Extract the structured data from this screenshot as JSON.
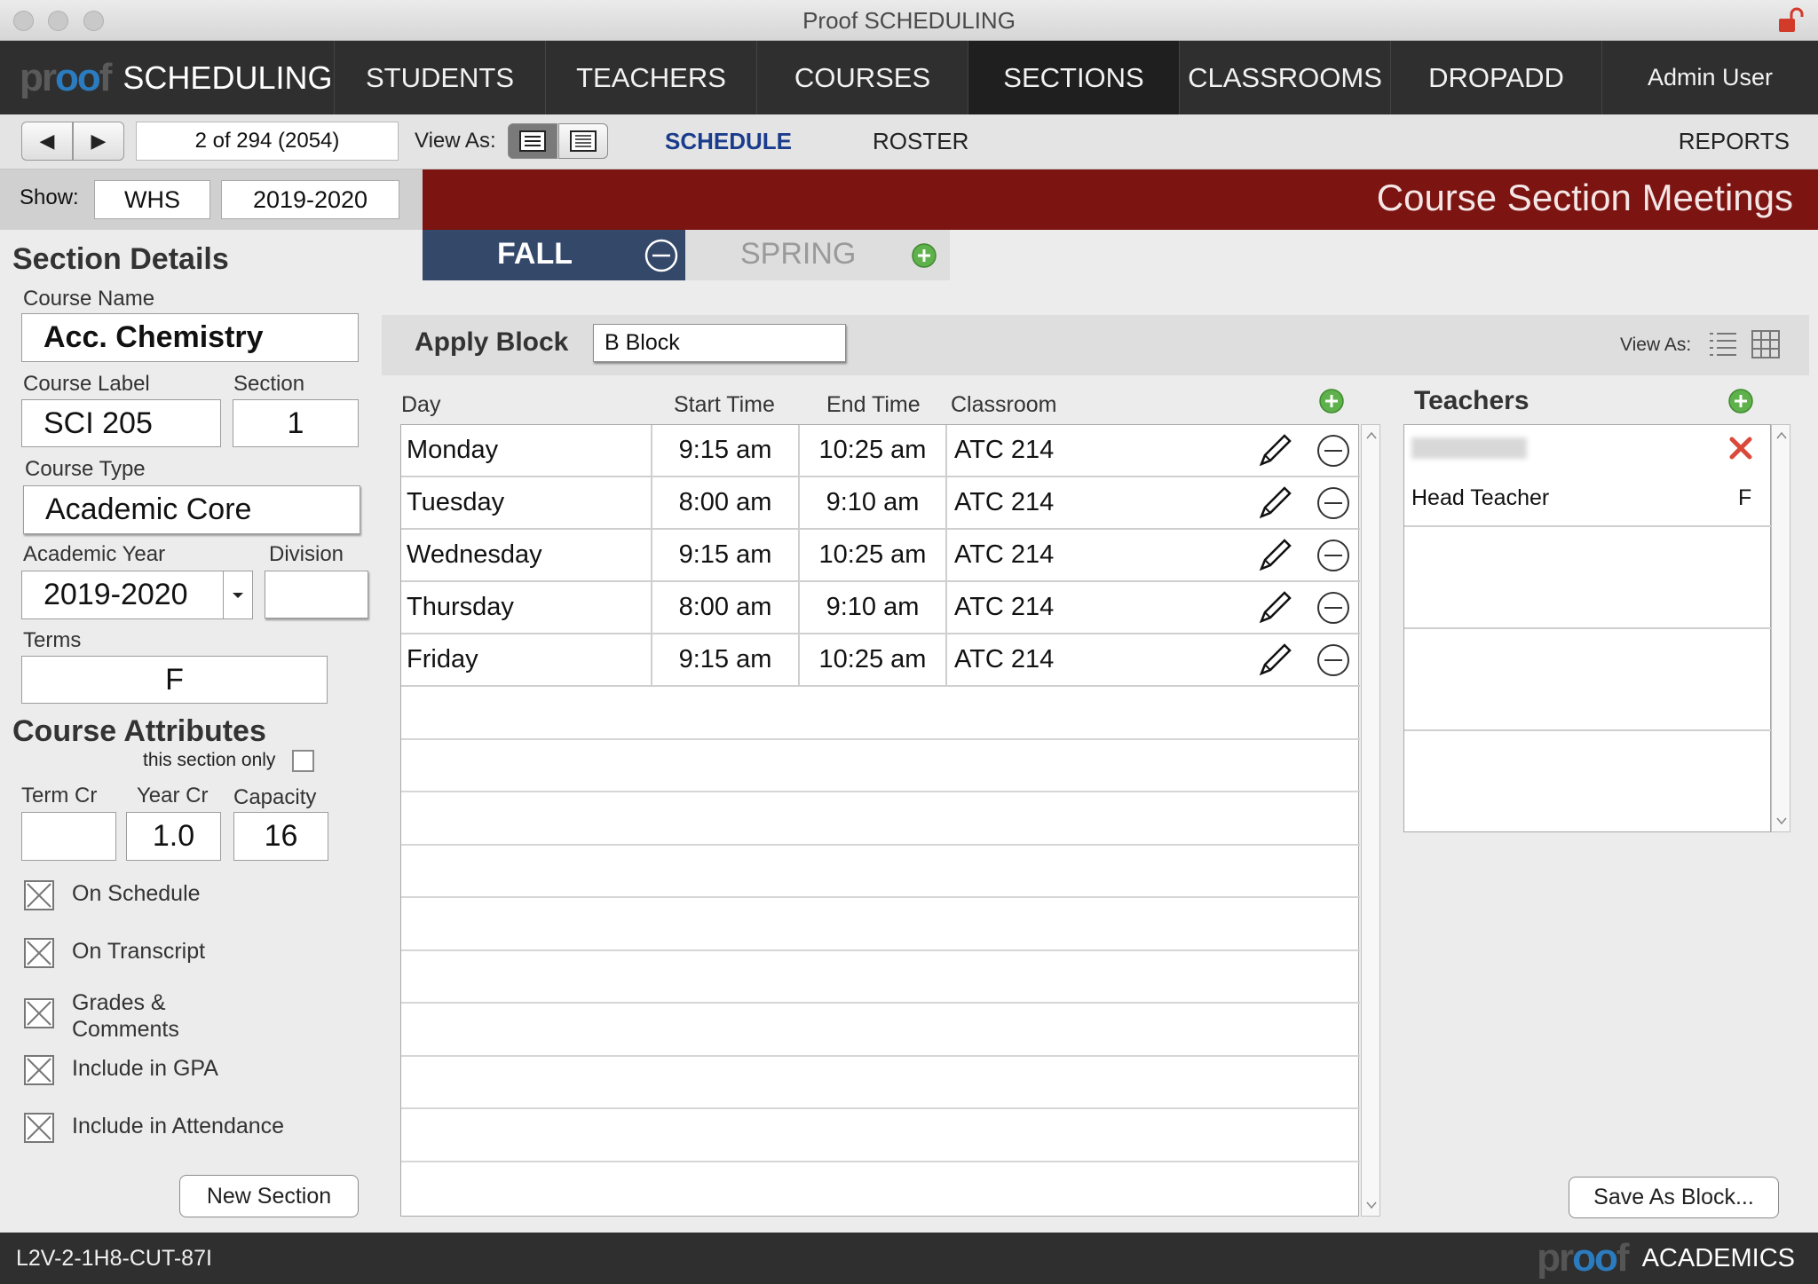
{
  "window": {
    "title": "Proof SCHEDULING"
  },
  "nav": {
    "brand_logo": "proof",
    "brand_label": "SCHEDULING",
    "items": [
      "STUDENTS",
      "TEACHERS",
      "COURSES",
      "SECTIONS",
      "CLASSROOMS",
      "DROPADD"
    ],
    "active": "SECTIONS",
    "user": "Admin User"
  },
  "toolbar": {
    "record": "2 of 294 (2054)",
    "view_as_label": "View As:",
    "schedule_label": "SCHEDULE",
    "roster_label": "ROSTER",
    "reports_label": "REPORTS",
    "active_color": "#1a3c8c"
  },
  "show": {
    "label": "Show:",
    "school": "WHS",
    "year": "2019-2020"
  },
  "banner": {
    "title": "Course Section Meetings",
    "color": "#7c1411"
  },
  "section_details": {
    "heading": "Section Details",
    "course_name_label": "Course Name",
    "course_name": "Acc. Chemistry",
    "course_label_label": "Course Label",
    "course_label": "SCI 205",
    "section_label": "Section",
    "section": "1",
    "course_type_label": "Course Type",
    "course_type": "Academic Core",
    "academic_year_label": "Academic Year",
    "academic_year": "2019-2020",
    "division_label": "Division",
    "division": "",
    "terms_label": "Terms",
    "terms": "F"
  },
  "course_attributes": {
    "heading": "Course Attributes",
    "this_section_only": "this section only",
    "term_cr_label": "Term Cr",
    "term_cr": "",
    "year_cr_label": "Year Cr",
    "year_cr": "1.0",
    "capacity_label": "Capacity",
    "capacity": "16",
    "checkboxes": [
      {
        "label": "On Schedule",
        "checked": true
      },
      {
        "label": "On Transcript",
        "checked": true
      },
      {
        "label": "Grades & Comments",
        "checked": true
      },
      {
        "label": "Include in GPA",
        "checked": true
      },
      {
        "label": "Include in Attendance",
        "checked": true
      }
    ],
    "new_section_label": "New Section"
  },
  "terms_tabs": {
    "fall": "FALL",
    "spring": "SPRING"
  },
  "apply_block": {
    "label": "Apply Block",
    "value": "B Block",
    "view_as_label": "View As:"
  },
  "meetings": {
    "headers": {
      "day": "Day",
      "start": "Start Time",
      "end": "End Time",
      "room": "Classroom"
    },
    "rows": [
      {
        "day": "Monday",
        "start": "9:15 am",
        "end": "10:25 am",
        "room": "ATC 214"
      },
      {
        "day": "Tuesday",
        "start": "8:00 am",
        "end": "9:10 am",
        "room": "ATC 214"
      },
      {
        "day": "Wednesday",
        "start": "9:15 am",
        "end": "10:25 am",
        "room": "ATC 214"
      },
      {
        "day": "Thursday",
        "start": "8:00 am",
        "end": "9:10 am",
        "room": "ATC 214"
      },
      {
        "day": "Friday",
        "start": "9:15 am",
        "end": "10:25 am",
        "room": "ATC 214"
      }
    ]
  },
  "teachers": {
    "heading": "Teachers",
    "rows": [
      {
        "name": "",
        "role": "Head Teacher",
        "term": "F"
      }
    ]
  },
  "save_block_label": "Save As Block...",
  "footer": {
    "code": "L2V-2-1H8-CUT-87I",
    "brand_logo": "proof",
    "brand_label": "ACADEMICS"
  }
}
